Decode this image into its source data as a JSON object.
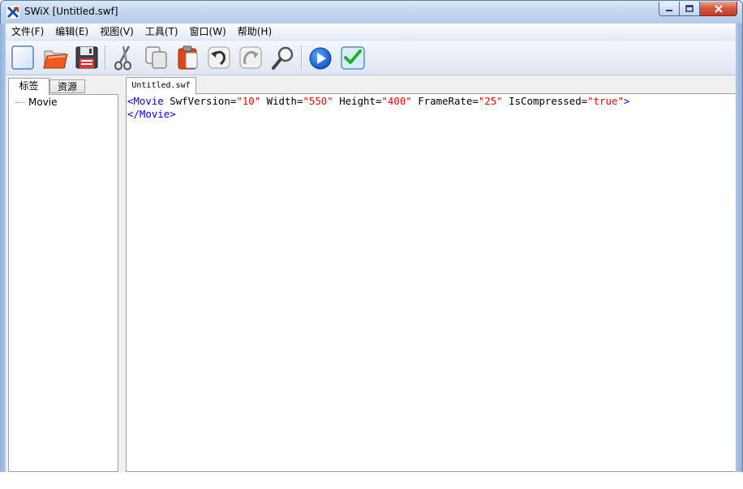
{
  "window": {
    "title": "SWiX [Untitled.swf]",
    "accent_color": "#b9cfea",
    "close_color": "#c53a22"
  },
  "menu": {
    "items": [
      {
        "label": "文件(F)"
      },
      {
        "label": "编辑(E)"
      },
      {
        "label": "视图(V)"
      },
      {
        "label": "工具(T)"
      },
      {
        "label": "窗口(W)"
      },
      {
        "label": "帮助(H)"
      }
    ]
  },
  "toolbar": {
    "buttons": [
      {
        "icon": "new-document-icon"
      },
      {
        "icon": "open-folder-icon"
      },
      {
        "icon": "save-disk-icon"
      },
      {
        "icon": "cut-scissors-icon"
      },
      {
        "icon": "copy-icon"
      },
      {
        "icon": "paste-clipboard-icon"
      },
      {
        "icon": "undo-icon"
      },
      {
        "icon": "redo-icon"
      },
      {
        "icon": "find-magnifier-icon"
      },
      {
        "icon": "play-icon"
      },
      {
        "icon": "validate-check-icon"
      }
    ]
  },
  "left_panel": {
    "tabs": [
      {
        "label": "标签",
        "active": true
      },
      {
        "label": "资源",
        "active": false
      }
    ],
    "tree": {
      "root_label": "Movie"
    }
  },
  "editor": {
    "tab_label": "Untitled.swf",
    "code": {
      "line1": {
        "open": "<",
        "tag": "Movie",
        "attrs": [
          {
            "name": "SwfVersion",
            "value": "\"10\""
          },
          {
            "name": "Width",
            "value": "\"550\""
          },
          {
            "name": "Height",
            "value": "\"400\""
          },
          {
            "name": "FrameRate",
            "value": "\"25\""
          },
          {
            "name": "IsCompressed",
            "value": "\"true\""
          }
        ],
        "close": ">"
      },
      "line2": {
        "open": "</",
        "tag": "Movie",
        "close": ">"
      }
    }
  }
}
